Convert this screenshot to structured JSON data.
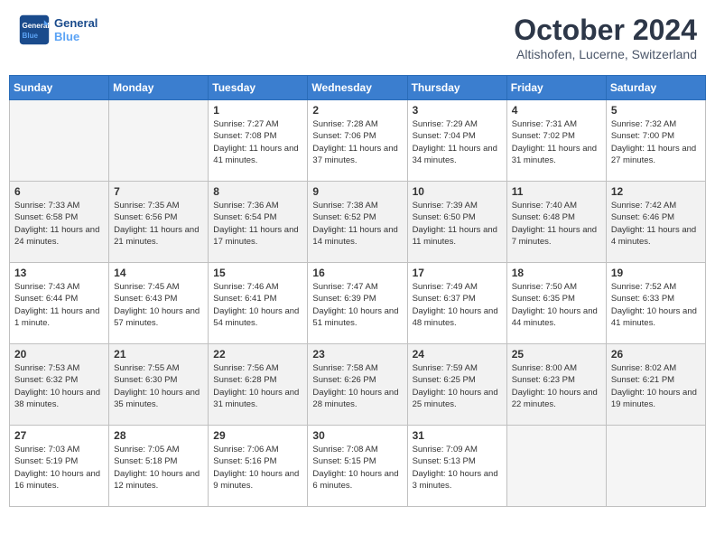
{
  "header": {
    "logo_line1": "General",
    "logo_line2": "Blue",
    "month": "October 2024",
    "location": "Altishofen, Lucerne, Switzerland"
  },
  "days_of_week": [
    "Sunday",
    "Monday",
    "Tuesday",
    "Wednesday",
    "Thursday",
    "Friday",
    "Saturday"
  ],
  "weeks": [
    [
      {
        "day": "",
        "info": ""
      },
      {
        "day": "",
        "info": ""
      },
      {
        "day": "1",
        "info": "Sunrise: 7:27 AM\nSunset: 7:08 PM\nDaylight: 11 hours and 41 minutes."
      },
      {
        "day": "2",
        "info": "Sunrise: 7:28 AM\nSunset: 7:06 PM\nDaylight: 11 hours and 37 minutes."
      },
      {
        "day": "3",
        "info": "Sunrise: 7:29 AM\nSunset: 7:04 PM\nDaylight: 11 hours and 34 minutes."
      },
      {
        "day": "4",
        "info": "Sunrise: 7:31 AM\nSunset: 7:02 PM\nDaylight: 11 hours and 31 minutes."
      },
      {
        "day": "5",
        "info": "Sunrise: 7:32 AM\nSunset: 7:00 PM\nDaylight: 11 hours and 27 minutes."
      }
    ],
    [
      {
        "day": "6",
        "info": "Sunrise: 7:33 AM\nSunset: 6:58 PM\nDaylight: 11 hours and 24 minutes."
      },
      {
        "day": "7",
        "info": "Sunrise: 7:35 AM\nSunset: 6:56 PM\nDaylight: 11 hours and 21 minutes."
      },
      {
        "day": "8",
        "info": "Sunrise: 7:36 AM\nSunset: 6:54 PM\nDaylight: 11 hours and 17 minutes."
      },
      {
        "day": "9",
        "info": "Sunrise: 7:38 AM\nSunset: 6:52 PM\nDaylight: 11 hours and 14 minutes."
      },
      {
        "day": "10",
        "info": "Sunrise: 7:39 AM\nSunset: 6:50 PM\nDaylight: 11 hours and 11 minutes."
      },
      {
        "day": "11",
        "info": "Sunrise: 7:40 AM\nSunset: 6:48 PM\nDaylight: 11 hours and 7 minutes."
      },
      {
        "day": "12",
        "info": "Sunrise: 7:42 AM\nSunset: 6:46 PM\nDaylight: 11 hours and 4 minutes."
      }
    ],
    [
      {
        "day": "13",
        "info": "Sunrise: 7:43 AM\nSunset: 6:44 PM\nDaylight: 11 hours and 1 minute."
      },
      {
        "day": "14",
        "info": "Sunrise: 7:45 AM\nSunset: 6:43 PM\nDaylight: 10 hours and 57 minutes."
      },
      {
        "day": "15",
        "info": "Sunrise: 7:46 AM\nSunset: 6:41 PM\nDaylight: 10 hours and 54 minutes."
      },
      {
        "day": "16",
        "info": "Sunrise: 7:47 AM\nSunset: 6:39 PM\nDaylight: 10 hours and 51 minutes."
      },
      {
        "day": "17",
        "info": "Sunrise: 7:49 AM\nSunset: 6:37 PM\nDaylight: 10 hours and 48 minutes."
      },
      {
        "day": "18",
        "info": "Sunrise: 7:50 AM\nSunset: 6:35 PM\nDaylight: 10 hours and 44 minutes."
      },
      {
        "day": "19",
        "info": "Sunrise: 7:52 AM\nSunset: 6:33 PM\nDaylight: 10 hours and 41 minutes."
      }
    ],
    [
      {
        "day": "20",
        "info": "Sunrise: 7:53 AM\nSunset: 6:32 PM\nDaylight: 10 hours and 38 minutes."
      },
      {
        "day": "21",
        "info": "Sunrise: 7:55 AM\nSunset: 6:30 PM\nDaylight: 10 hours and 35 minutes."
      },
      {
        "day": "22",
        "info": "Sunrise: 7:56 AM\nSunset: 6:28 PM\nDaylight: 10 hours and 31 minutes."
      },
      {
        "day": "23",
        "info": "Sunrise: 7:58 AM\nSunset: 6:26 PM\nDaylight: 10 hours and 28 minutes."
      },
      {
        "day": "24",
        "info": "Sunrise: 7:59 AM\nSunset: 6:25 PM\nDaylight: 10 hours and 25 minutes."
      },
      {
        "day": "25",
        "info": "Sunrise: 8:00 AM\nSunset: 6:23 PM\nDaylight: 10 hours and 22 minutes."
      },
      {
        "day": "26",
        "info": "Sunrise: 8:02 AM\nSunset: 6:21 PM\nDaylight: 10 hours and 19 minutes."
      }
    ],
    [
      {
        "day": "27",
        "info": "Sunrise: 7:03 AM\nSunset: 5:19 PM\nDaylight: 10 hours and 16 minutes."
      },
      {
        "day": "28",
        "info": "Sunrise: 7:05 AM\nSunset: 5:18 PM\nDaylight: 10 hours and 12 minutes."
      },
      {
        "day": "29",
        "info": "Sunrise: 7:06 AM\nSunset: 5:16 PM\nDaylight: 10 hours and 9 minutes."
      },
      {
        "day": "30",
        "info": "Sunrise: 7:08 AM\nSunset: 5:15 PM\nDaylight: 10 hours and 6 minutes."
      },
      {
        "day": "31",
        "info": "Sunrise: 7:09 AM\nSunset: 5:13 PM\nDaylight: 10 hours and 3 minutes."
      },
      {
        "day": "",
        "info": ""
      },
      {
        "day": "",
        "info": ""
      }
    ]
  ]
}
